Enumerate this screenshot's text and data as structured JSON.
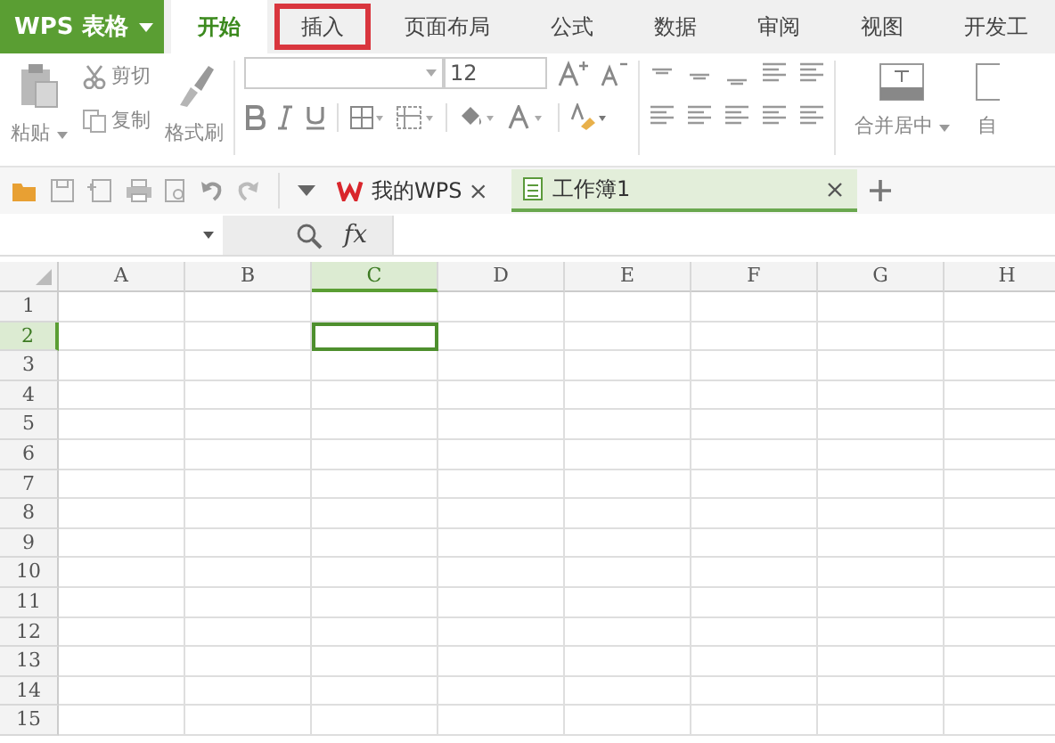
{
  "app": {
    "name": "WPS 表格"
  },
  "menu_tabs": [
    {
      "label": "开始",
      "selected": true,
      "highlighted": false
    },
    {
      "label": "插入",
      "selected": false,
      "highlighted": true
    },
    {
      "label": "页面布局",
      "selected": false,
      "highlighted": false
    },
    {
      "label": "公式",
      "selected": false,
      "highlighted": false
    },
    {
      "label": "数据",
      "selected": false,
      "highlighted": false
    },
    {
      "label": "审阅",
      "selected": false,
      "highlighted": false
    },
    {
      "label": "视图",
      "selected": false,
      "highlighted": false
    },
    {
      "label": "开发工",
      "selected": false,
      "highlighted": false
    }
  ],
  "ribbon": {
    "paste": "粘贴",
    "cut": "剪切",
    "copy": "复制",
    "format_painter": "格式刷",
    "font_size": "12",
    "merge": "合并居中",
    "next_group": "自"
  },
  "doc_tabs": [
    {
      "label": "我的WPS",
      "kind": "home",
      "selected": false
    },
    {
      "label": "工作簿1",
      "kind": "workbook",
      "selected": true
    }
  ],
  "formula_bar": {
    "function_label": "fx"
  },
  "sheet": {
    "columns": [
      {
        "label": "A",
        "selected": false
      },
      {
        "label": "B",
        "selected": false
      },
      {
        "label": "C",
        "selected": true
      },
      {
        "label": "D",
        "selected": false
      },
      {
        "label": "E",
        "selected": false
      },
      {
        "label": "F",
        "selected": false
      },
      {
        "label": "G",
        "selected": false
      },
      {
        "label": "H",
        "selected": false
      }
    ],
    "rows": [
      {
        "label": "1",
        "selected": false
      },
      {
        "label": "2",
        "selected": true
      },
      {
        "label": "3",
        "selected": false
      },
      {
        "label": "4",
        "selected": false
      },
      {
        "label": "5",
        "selected": false
      },
      {
        "label": "6",
        "selected": false
      },
      {
        "label": "7",
        "selected": false
      },
      {
        "label": "8",
        "selected": false
      },
      {
        "label": "9",
        "selected": false
      },
      {
        "label": "10",
        "selected": false
      },
      {
        "label": "11",
        "selected": false
      },
      {
        "label": "12",
        "selected": false
      },
      {
        "label": "13",
        "selected": false
      },
      {
        "label": "14",
        "selected": false
      },
      {
        "label": "15",
        "selected": false
      }
    ]
  }
}
